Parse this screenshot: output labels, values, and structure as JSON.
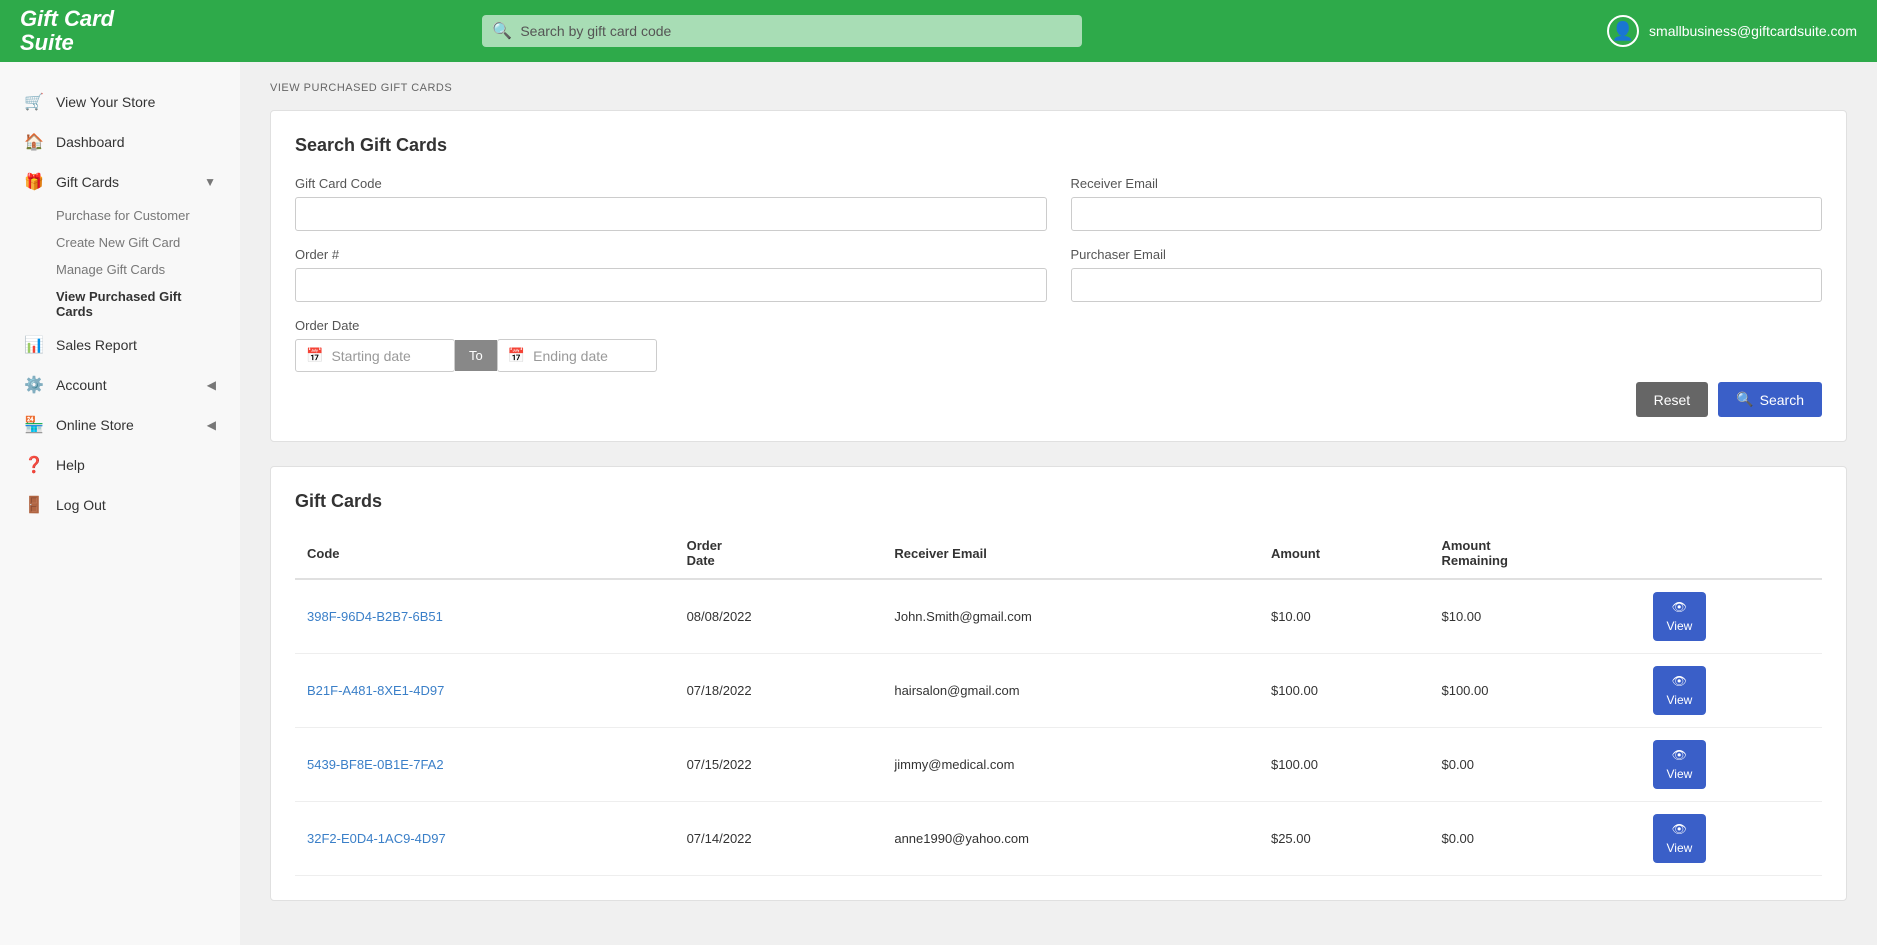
{
  "header": {
    "logo_line1": "Gift Card",
    "logo_line2": "Suite",
    "search_placeholder": "Search by gift card code",
    "user_email": "smallbusiness@giftcardsuite.com"
  },
  "sidebar": {
    "items": [
      {
        "id": "view-store",
        "label": "View Your Store",
        "icon": "🛒",
        "arrow": ""
      },
      {
        "id": "dashboard",
        "label": "Dashboard",
        "icon": "🏠",
        "arrow": ""
      },
      {
        "id": "gift-cards",
        "label": "Gift Cards",
        "icon": "🎁",
        "arrow": "▼"
      },
      {
        "id": "sales-report",
        "label": "Sales Report",
        "icon": "📊",
        "arrow": ""
      },
      {
        "id": "account",
        "label": "Account",
        "icon": "⚙️",
        "arrow": "◀"
      },
      {
        "id": "online-store",
        "label": "Online Store",
        "icon": "🏪",
        "arrow": "◀"
      },
      {
        "id": "help",
        "label": "Help",
        "icon": "❓",
        "arrow": ""
      },
      {
        "id": "log-out",
        "label": "Log Out",
        "icon": "🚪",
        "arrow": ""
      }
    ],
    "gift_card_subitems": [
      {
        "id": "purchase-for-customer",
        "label": "Purchase for Customer",
        "active": false
      },
      {
        "id": "create-new-gift-card",
        "label": "Create New Gift Card",
        "active": false
      },
      {
        "id": "manage-gift-cards",
        "label": "Manage Gift Cards",
        "active": false
      },
      {
        "id": "view-purchased-gift-cards",
        "label": "View Purchased Gift Cards",
        "active": true
      }
    ]
  },
  "breadcrumb": "VIEW PURCHASED GIFT CARDS",
  "search_section": {
    "title": "Search Gift Cards",
    "gift_card_code_label": "Gift Card Code",
    "gift_card_code_placeholder": "",
    "receiver_email_label": "Receiver Email",
    "receiver_email_placeholder": "",
    "order_number_label": "Order #",
    "order_number_placeholder": "",
    "purchaser_email_label": "Purchaser Email",
    "purchaser_email_placeholder": "",
    "order_date_label": "Order Date",
    "starting_date_placeholder": "Starting date",
    "to_label": "To",
    "ending_date_placeholder": "Ending date",
    "reset_label": "Reset",
    "search_label": "Search"
  },
  "table": {
    "title": "Gift Cards",
    "columns": [
      "Code",
      "Order Date",
      "Receiver Email",
      "Amount",
      "Amount Remaining",
      ""
    ],
    "rows": [
      {
        "code": "398F-96D4-B2B7-6B51",
        "order_date": "08/08/2022",
        "receiver_email": "John.Smith@gmail.com",
        "amount": "$10.00",
        "amount_remaining": "$10.00",
        "view_label": "View"
      },
      {
        "code": "B21F-A481-8XE1-4D97",
        "order_date": "07/18/2022",
        "receiver_email": "hairsalon@gmail.com",
        "amount": "$100.00",
        "amount_remaining": "$100.00",
        "view_label": "View"
      },
      {
        "code": "5439-BF8E-0B1E-7FA2",
        "order_date": "07/15/2022",
        "receiver_email": "jimmy@medical.com",
        "amount": "$100.00",
        "amount_remaining": "$0.00",
        "view_label": "View"
      },
      {
        "code": "32F2-E0D4-1AC9-4D97",
        "order_date": "07/14/2022",
        "receiver_email": "anne1990@yahoo.com",
        "amount": "$25.00",
        "amount_remaining": "$0.00",
        "view_label": "View"
      }
    ]
  }
}
